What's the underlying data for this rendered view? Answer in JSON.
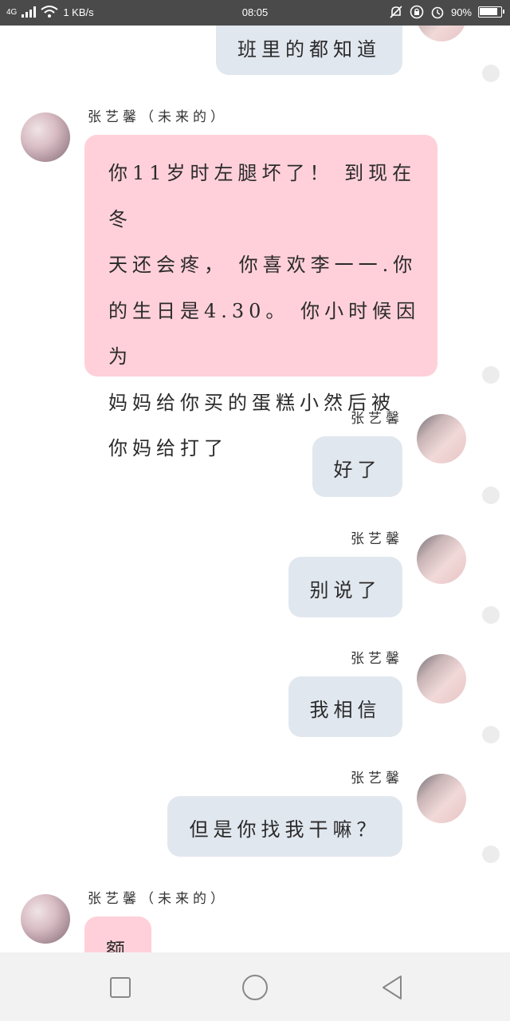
{
  "statusbar": {
    "network": "4G",
    "speed": "1 KB/s",
    "time": "08:05",
    "battery_percent": "90%",
    "battery_level": 0.9
  },
  "messages": [
    {
      "sender": "",
      "text": [
        "班里的都知道"
      ],
      "side": "right"
    },
    {
      "sender": "张艺馨（未来的）",
      "text": [
        "你11岁时左腿坏了！ 到现在冬",
        "天还会疼， 你喜欢李一一.你",
        "的生日是4.30。 你小时候因为",
        "妈妈给你买的蛋糕小然后被",
        "你妈给打了"
      ],
      "side": "left"
    },
    {
      "sender": "张艺馨",
      "text": [
        "好了"
      ],
      "side": "right"
    },
    {
      "sender": "张艺馨",
      "text": [
        "别说了"
      ],
      "side": "right"
    },
    {
      "sender": "张艺馨",
      "text": [
        "我相信"
      ],
      "side": "right"
    },
    {
      "sender": "张艺馨",
      "text": [
        "但是你找我干嘛？"
      ],
      "side": "right"
    },
    {
      "sender": "张艺馨（未来的）",
      "text": [
        "额"
      ],
      "side": "left"
    }
  ],
  "navbar": {
    "recent_icon": "square-icon",
    "home_icon": "circle-icon",
    "back_icon": "triangle-back-icon"
  }
}
